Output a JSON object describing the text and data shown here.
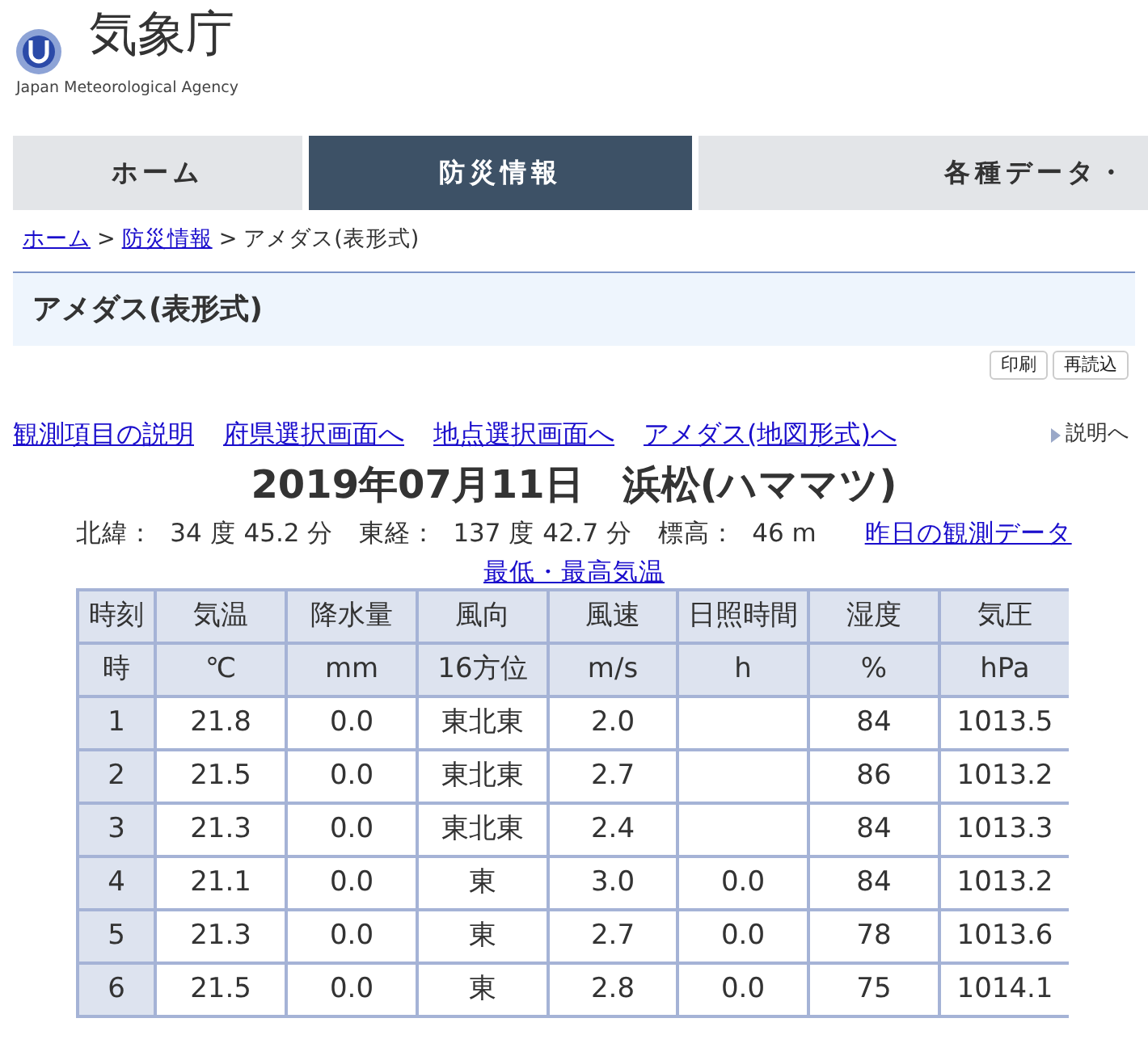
{
  "header": {
    "title": "気象庁",
    "subtitle": "Japan Meteorological Agency"
  },
  "nav": [
    {
      "label": "ホーム",
      "selected": false
    },
    {
      "label": "防災情報",
      "selected": true
    },
    {
      "label": "各種データ・",
      "selected": false
    }
  ],
  "breadcrumb": [
    {
      "label": "ホーム",
      "kind": "link"
    },
    {
      "separator": ">",
      "label": "防災情報",
      "kind": "link"
    },
    {
      "separator": ">",
      "label": "アメダス(表形式)",
      "kind": "current"
    }
  ],
  "page_title": "アメダス(表形式)",
  "buttons": [
    "印刷",
    "再読込"
  ],
  "links": [
    "観測項目の説明",
    "府県選択画面へ",
    "地点選択画面へ",
    "アメダス(地図形式)へ"
  ],
  "help_link": "説明へ",
  "heading": "2019年07月11日　浜松(ハママツ)",
  "location": [
    "北緯：",
    "34 度 45.2 分",
    "東経：",
    "137 度 42.7 分",
    "標高：",
    "46 m"
  ],
  "location_links": [
    "昨日の観測データ",
    "最低・最高気温"
  ],
  "table": {
    "columns": [
      "時刻",
      "気温",
      "降水量",
      "風向",
      "風速",
      "日照時間",
      "湿度",
      "気圧"
    ],
    "units": [
      "時",
      "℃",
      "mm",
      "16方位",
      "m/s",
      "h",
      "%",
      "hPa"
    ],
    "rows": [
      [
        "1",
        "21.8",
        "0.0",
        "東北東",
        "2.0",
        null,
        "84",
        "1013.5"
      ],
      [
        "2",
        "21.5",
        "0.0",
        "東北東",
        "2.7",
        null,
        "86",
        "1013.2"
      ],
      [
        "3",
        "21.3",
        "0.0",
        "東北東",
        "2.4",
        null,
        "84",
        "1013.3"
      ],
      [
        "4",
        "21.1",
        "0.0",
        "東",
        "3.0",
        "0.0",
        "84",
        "1013.2"
      ],
      [
        "5",
        "21.3",
        "0.0",
        "東",
        "2.7",
        "0.0",
        "78",
        "1013.6"
      ],
      [
        "6",
        "21.5",
        "0.0",
        "東",
        "2.8",
        "0.0",
        "75",
        "1014.1"
      ]
    ]
  }
}
